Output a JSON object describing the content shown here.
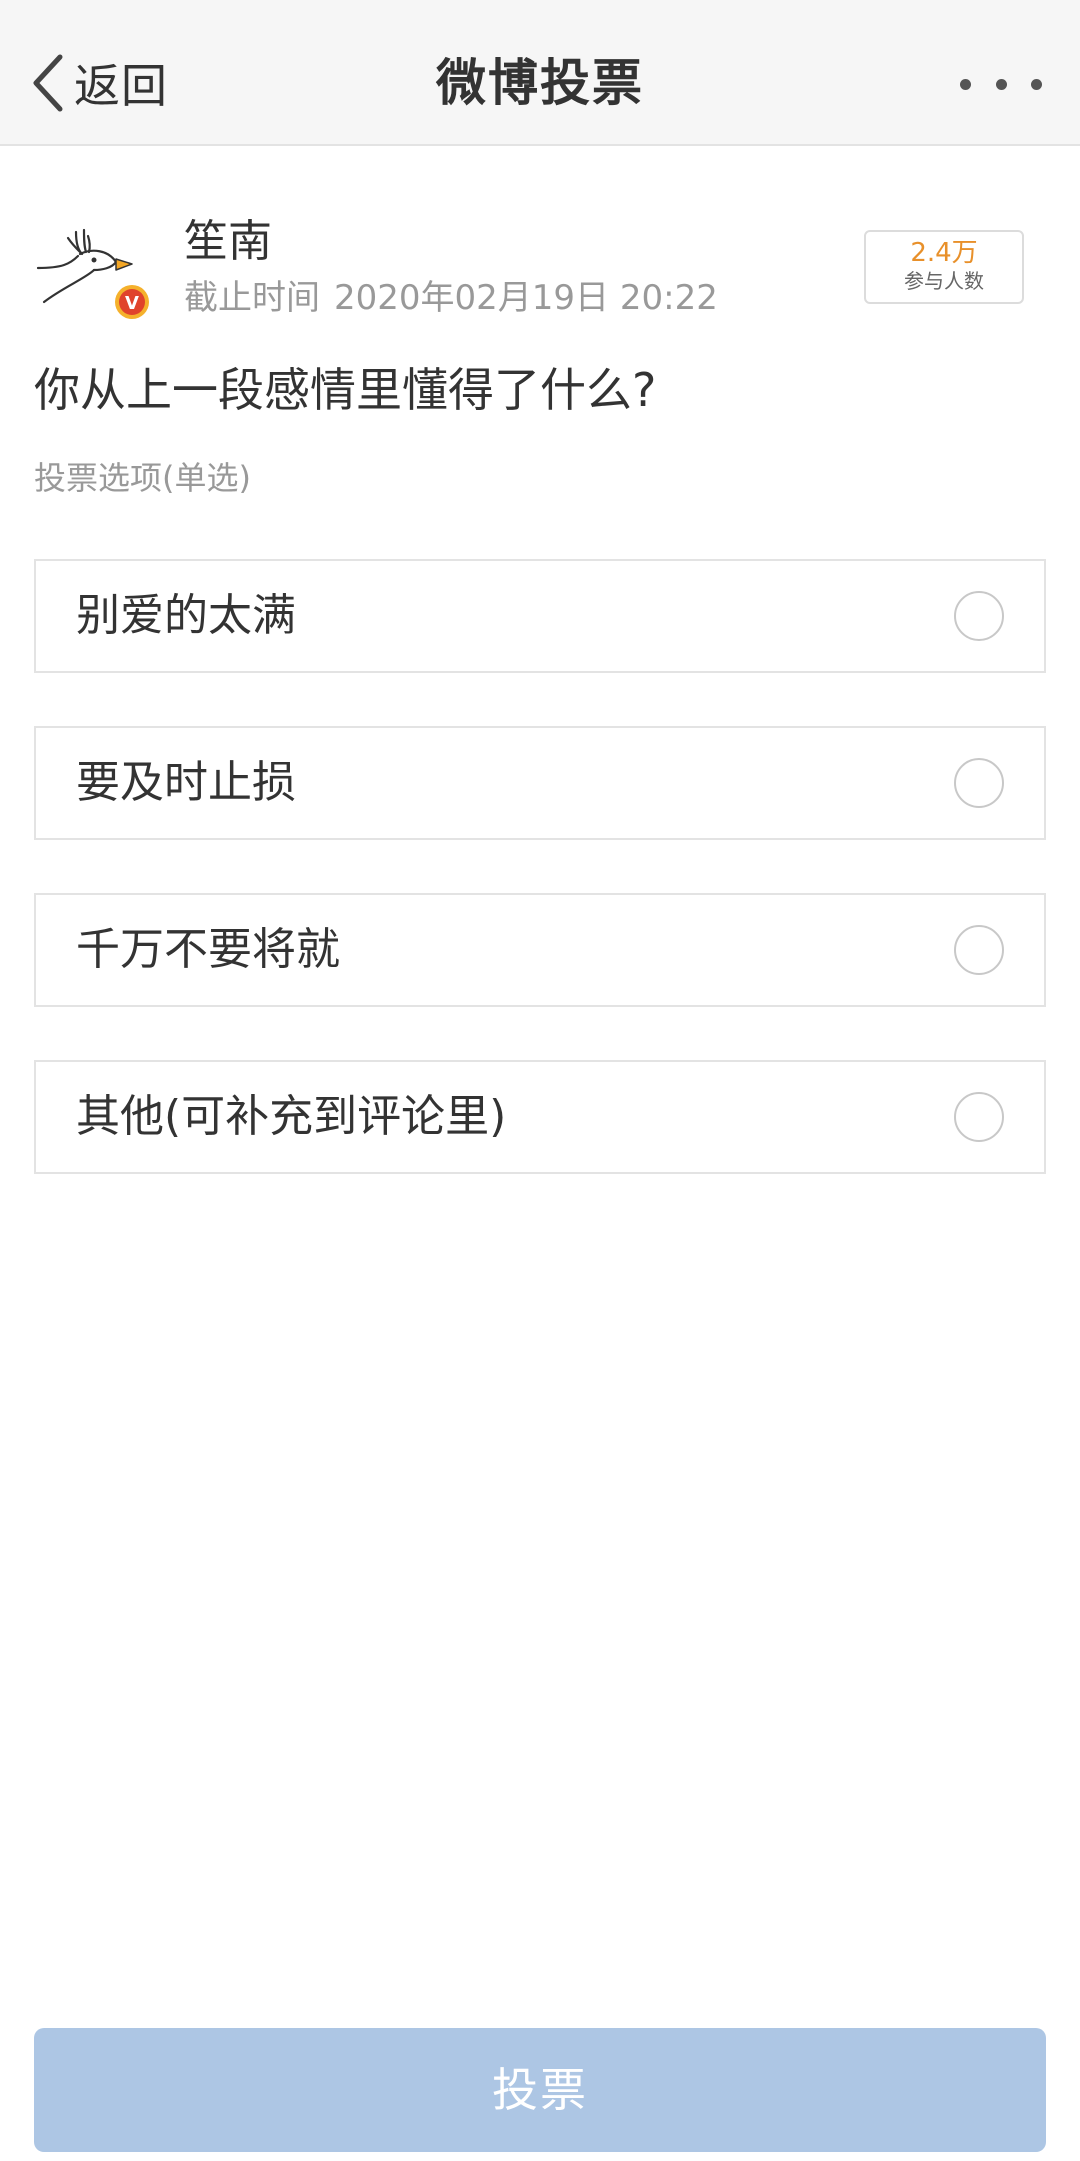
{
  "navbar": {
    "back_label": "返回",
    "title": "微博投票",
    "back_icon": "chevron-left-icon",
    "more_icon": "more-dots-icon"
  },
  "author": {
    "name": "笙南",
    "deadline_label": "截止时间",
    "deadline_value": "2020年02月19日 20:22",
    "verified_badge": "V"
  },
  "participants": {
    "count": "2.4万",
    "label": "参与人数"
  },
  "poll": {
    "question": "你从上一段感情里懂得了什么?",
    "vote_type": "投票选项(单选)",
    "options": [
      {
        "label": "别爱的太满"
      },
      {
        "label": "要及时止损"
      },
      {
        "label": "千万不要将就"
      },
      {
        "label": "其他(可补充到评论里)"
      }
    ],
    "submit_label": "投票"
  },
  "colors": {
    "accent_orange": "#e8902a",
    "submit_disabled": "#adc6e4",
    "badge_red": "#e0432b",
    "badge_ring": "#f5b12c"
  }
}
